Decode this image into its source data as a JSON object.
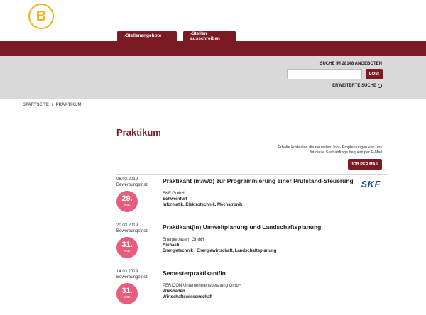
{
  "header": {
    "logo_letter": "B",
    "tabs": [
      {
        "label": "›Stellenangebote"
      },
      {
        "label": "›Stellen ausschreiben"
      }
    ]
  },
  "search": {
    "label": "SUCHE IM 28148 ANGEBOTEN",
    "placeholder": "",
    "button_label": "LOS!",
    "advanced_label": "ERWEITERTE SUCHE"
  },
  "breadcrumb": {
    "items": [
      "STARTSEITE",
      "/",
      "PRAKTIKUM"
    ]
  },
  "main": {
    "title": "Praktikum",
    "mail_text_1": "Erhalte kostenlos die neuesten Job - Empfehlungen von uns",
    "mail_text_2": "für diese Suchanfrage bequem per E-Mail",
    "mail_button": "JOB PER MAIL"
  },
  "jobs": [
    {
      "date": "08.03.2019",
      "deadline_label": "Bewerbungsfrist:",
      "day": "29.",
      "month": "Mar.",
      "title": "Praktikant (m/w/d) zur Programmierung einer Prüfstand-Steuerung",
      "company": "SKF GmbH",
      "city": "Schweinfurt",
      "field": "Informatik, Elektrotechnik, Mechatronik",
      "company_logo": "SKF"
    },
    {
      "date": "20.03.2019",
      "deadline_label": "Bewerbungsfrist:",
      "day": "31.",
      "month": "Mar.",
      "title": "Praktikant(in) Umweltplanung und Landschaftsplanung",
      "company": "Energiebauern GmbH",
      "city": "Aichach",
      "field": "Energietechnik / Energiewirtschaft, Landschaftsplanung"
    },
    {
      "date": "14.03.2019",
      "deadline_label": "Bewerbungsfrist:",
      "day": "31.",
      "month": "Mar.",
      "title": "Semesterpraktikant/in",
      "company": "PERICON Unternehmensberatung GmbH",
      "city": "Wiesbaden",
      "field": "Wirtschaftswissenschaft"
    }
  ],
  "colors": {
    "brand": "#7b1a22",
    "badge": "#e85d7a",
    "logo": "#f0b31d"
  }
}
